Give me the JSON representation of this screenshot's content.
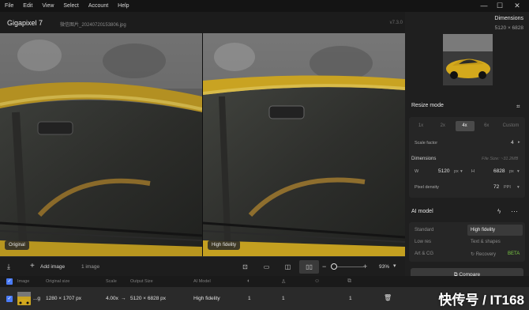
{
  "menu": [
    "File",
    "Edit",
    "View",
    "Select",
    "Account",
    "Help"
  ],
  "window": {
    "minimize_icon": "minimize-icon",
    "maximize_icon": "maximize-icon",
    "close_icon": "close-icon"
  },
  "header": {
    "app_title": "Gigapixel 7",
    "file_name": "微信图片_20240720153806.jpg",
    "version": "v7.3.0"
  },
  "viewer": {
    "left_label": "Original",
    "right_label": "High fidelity"
  },
  "side": {
    "dimensions_title": "Dimensions",
    "dimensions_value": "5120 × 6828",
    "resize_title": "Resize mode",
    "scales": [
      "1x",
      "2x",
      "4x",
      "6x",
      "Custom"
    ],
    "active_scale": "4x",
    "scale_factor_label": "Scale factor",
    "scale_factor_value": "4",
    "dimensions_label": "Dimensions",
    "file_size": "File Size: ~31.2MB",
    "width_label": "W",
    "width_value": "5120",
    "width_unit": "px",
    "height_label": "H",
    "height_value": "6828",
    "height_unit": "px",
    "pixel_density_label": "Pixel density",
    "pixel_density_value": "72",
    "pixel_density_unit": "PPI",
    "ai_model_title": "AI model",
    "models_left": [
      "Standard",
      "Low res",
      "Art & CG"
    ],
    "models_right": [
      "High fidelity",
      "Text & shapes",
      "Recovery"
    ],
    "selected_model": "High fidelity",
    "beta": "BETA",
    "compare": "Compare"
  },
  "toolbar": {
    "add_image": "Add image",
    "image_count": "1 image",
    "zoom": "93%"
  },
  "table": {
    "headers": [
      "Image",
      "Original size",
      "Scale",
      "Output Size",
      "AI Model"
    ],
    "row": {
      "name": "...g",
      "original_size": "1280 × 1707 px",
      "scale": "4.00x",
      "arrow": "→",
      "output_size": "5120 × 6828 px",
      "model": "High fidelity",
      "col_a": "1",
      "col_b": "1",
      "col_c": "1"
    }
  },
  "watermark": "快传号 / IT168",
  "colors": {
    "accent": "#4a7bf7",
    "beta": "#7ac943",
    "car_yellow": "#c9a322"
  }
}
